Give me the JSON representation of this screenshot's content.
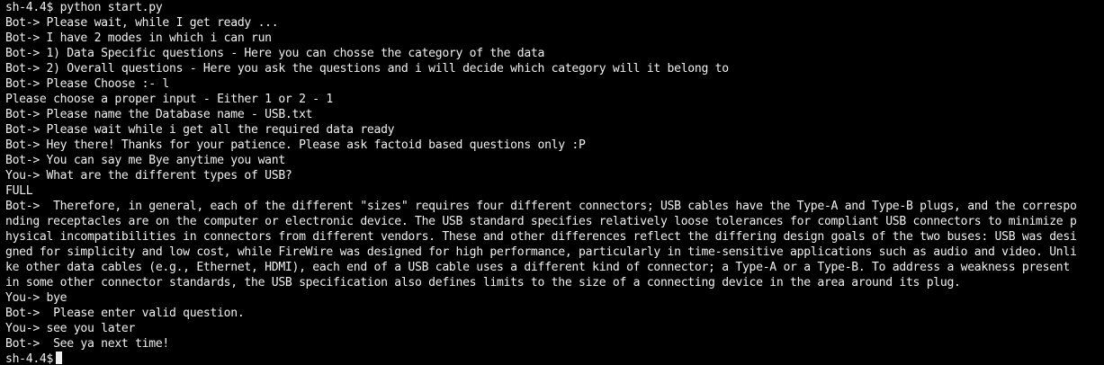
{
  "terminal": {
    "lines": [
      "sh-4.4$ python start.py",
      "Bot-> Please wait, while I get ready ...",
      "Bot-> I have 2 modes in which i can run",
      "Bot-> 1) Data Specific questions - Here you can chosse the category of the data",
      "Bot-> 2) Overall questions - Here you ask the questions and i will decide which category will it belong to",
      "Bot-> Please Choose :- l",
      "Please choose a proper input - Either 1 or 2 - 1",
      "Bot-> Please name the Database name - USB.txt",
      "Bot-> Please wait while i get all the required data ready",
      "Bot-> Hey there! Thanks for your patience. Please ask factoid based questions only :P",
      "Bot-> You can say me Bye anytime you want",
      "You-> What are the different types of USB?",
      "FULL",
      "Bot->  Therefore, in general, each of the different \"sizes\" requires four different connectors; USB cables have the Type-A and Type-B plugs, and the correspo",
      "nding receptacles are on the computer or electronic device. The USB standard specifies relatively loose tolerances for compliant USB connectors to minimize p",
      "hysical incompatibilities in connectors from different vendors. These and other differences reflect the differing design goals of the two buses: USB was desi",
      "gned for simplicity and low cost, while FireWire was designed for high performance, particularly in time-sensitive applications such as audio and video. Unli",
      "ke other data cables (e.g., Ethernet, HDMI), each end of a USB cable uses a different kind of connector; a Type-A or a Type-B. To address a weakness present",
      "in some other connector standards, the USB specification also defines limits to the size of a connecting device in the area around its plug.",
      "You-> bye",
      "Bot->  Please enter valid question.",
      "You-> see you later",
      "Bot->  See ya next time!"
    ],
    "prompt": "sh-4.4$",
    "colors": {
      "background": "#000000",
      "foreground": "#f0f0f0"
    }
  }
}
